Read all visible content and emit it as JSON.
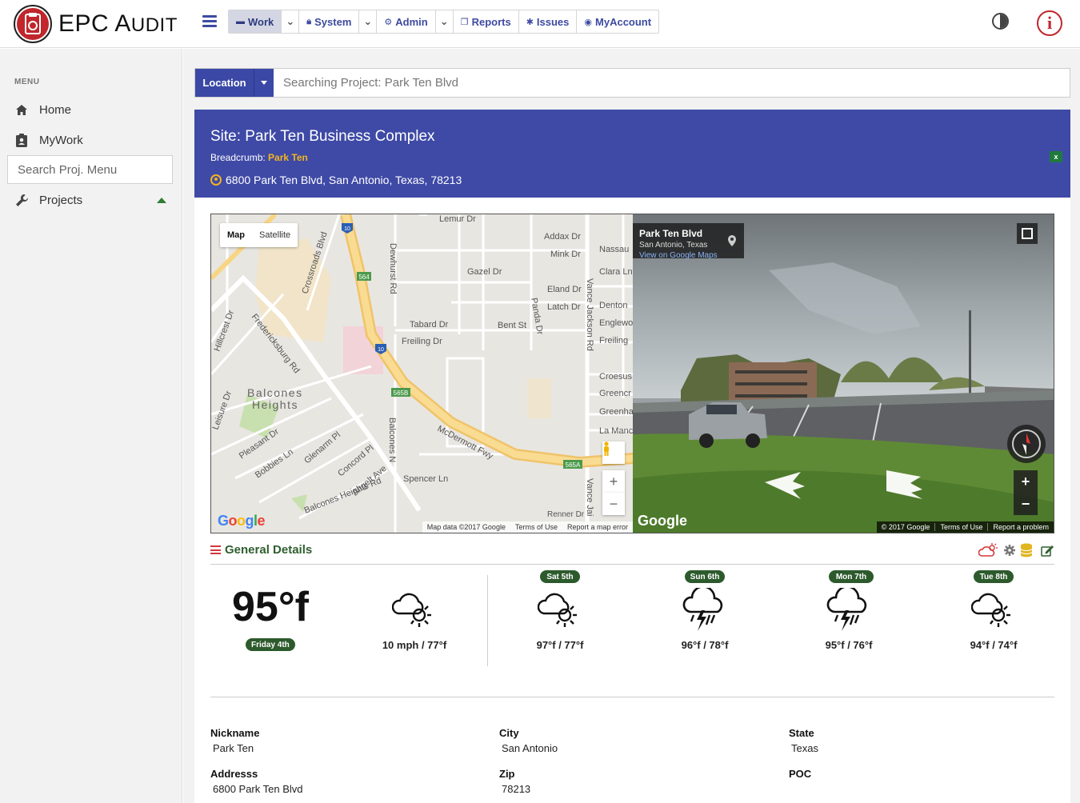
{
  "brand": {
    "name_big": "EPC A",
    "name_small": "UDIT"
  },
  "nav": [
    {
      "label": "Work",
      "icon": "folder-icon",
      "active": true
    },
    {
      "label": "System",
      "icon": "lock-icon"
    },
    {
      "label": "Admin",
      "icon": "cogs-icon"
    },
    {
      "label": "Reports",
      "icon": "files-icon"
    },
    {
      "label": "Issues",
      "icon": "bug-icon"
    },
    {
      "label": "MyAccount",
      "icon": "user-circle-icon"
    }
  ],
  "sidebar": {
    "menu_label": "MENU",
    "items": [
      {
        "label": "Home"
      },
      {
        "label": "MyWork"
      },
      {
        "label": "Projects"
      }
    ],
    "search_placeholder": "Search Proj. Menu"
  },
  "location": {
    "button": "Location",
    "placeholder": "Searching Project: Park Ten Blvd"
  },
  "site": {
    "title": "Site: Park Ten Business Complex",
    "breadcrumb_label": "Breadcrumb:",
    "breadcrumb_link": "Park Ten",
    "address": "6800 Park Ten Blvd, San Antonio, Texas, 78213"
  },
  "map": {
    "type_map": "Map",
    "type_satellite": "Satellite",
    "labels": {
      "lemur": "Lemur Dr",
      "addax": "Addax Dr",
      "mink": "Mink Dr",
      "nassau": "Nassau",
      "gazel": "Gazel Dr",
      "clara": "Clara Ln",
      "eland": "Eland Dr",
      "latch": "Latch Dr",
      "denton": "Denton",
      "englewood": "Englewo",
      "tabard": "Tabard Dr",
      "bent": "Bent St",
      "freiling": "Freiling Dr",
      "freiling2": "Freiling",
      "balcones_heights_1": "Balcones",
      "balcones_heights_2": "Heights",
      "mcdermott": "McDermott Fwy",
      "spencer": "Spencer Ln",
      "crossroads": "Crossroads Blvd",
      "fredericksburg": "Fredericksburg Rd",
      "hillcrest": "Hillcrest Dr",
      "dewhurst": "Dewhurst Rd",
      "vance_jackson": "Vance Jackson Rd",
      "balcones_n": "Balcones N",
      "pleasant": "Pleasant Dr",
      "bobbies": "Bobbies Ln",
      "glenarm": "Glenarm Pl",
      "concord": "Concord Pl",
      "altgelt": "Altgelt Ave",
      "balcones_heights_rd": "Balcones Heights Rd",
      "leisure": "Leisure Dr",
      "crosus": "Croesus",
      "greencr": "Greencr",
      "greenha": "Greenha",
      "lamanc": "La Manc",
      "renner": "Renner Dr",
      "panda": "Panda Dr",
      "vance_jai": "Vance Jai",
      "i10_top": "10",
      "i10_mid": "10",
      "s564": "564",
      "s565b": "565B",
      "s565a": "565A"
    },
    "google": "Google",
    "footer": [
      "Map data ©2017 Google",
      "Terms of Use",
      "Report a map error"
    ]
  },
  "street": {
    "title": "Park Ten Blvd",
    "subtitle": "San Antonio, Texas",
    "link": "View on Google Maps",
    "google": "Google",
    "footer": [
      "© 2017 Google",
      "Terms of Use",
      "Report a problem"
    ]
  },
  "details": {
    "title": "General Details",
    "current": {
      "temp": "95°f",
      "day": "Friday 4th",
      "wind": "10 mph / 77°f"
    },
    "forecast": [
      {
        "day": "Sat 5th",
        "temps": "97°f / 77°f",
        "icon": "partly-cloudy-icon"
      },
      {
        "day": "Sun 6th",
        "temps": "96°f / 78°f",
        "icon": "thunderstorm-icon"
      },
      {
        "day": "Mon 7th",
        "temps": "95°f / 76°f",
        "icon": "thunderstorm-icon"
      },
      {
        "day": "Tue 8th",
        "temps": "94°f / 74°f",
        "icon": "partly-cloudy-icon"
      }
    ],
    "fields": {
      "nickname_label": "Nickname",
      "nickname": "Park Ten",
      "city_label": "City",
      "city": "San Antonio",
      "state_label": "State",
      "state": "Texas",
      "address_label": "Addresss",
      "address": "6800 Park Ten Blvd",
      "zip_label": "Zip",
      "zip": "78213",
      "poc_label": "POC"
    }
  }
}
